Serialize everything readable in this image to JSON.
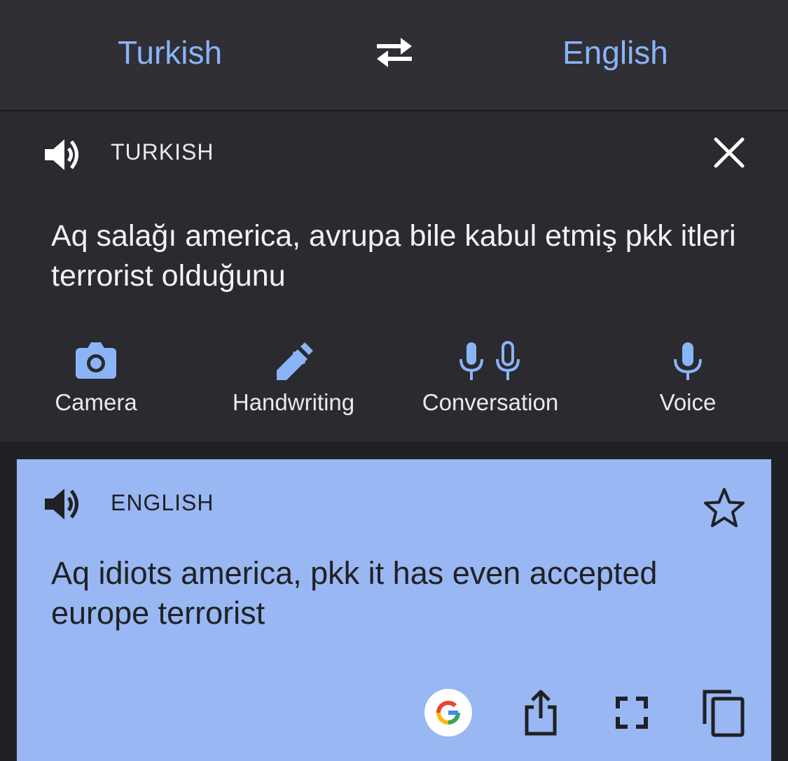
{
  "language_bar": {
    "source_language": "Turkish",
    "target_language": "English",
    "swap_icon": "swap-arrows-icon"
  },
  "input_panel": {
    "label": "TURKISH",
    "text": "Aq salağı america, avrupa bile kabul etmiş pkk itleri terrorist olduğunu",
    "tools": [
      {
        "label": "Camera",
        "icon": "camera-icon"
      },
      {
        "label": "Handwriting",
        "icon": "pen-icon"
      },
      {
        "label": "Conversation",
        "icon": "dual-microphone-icon"
      },
      {
        "label": "Voice",
        "icon": "microphone-icon"
      }
    ]
  },
  "output_panel": {
    "label": "ENGLISH",
    "text": "Aq idiots america, pkk it has even accepted europe terrorist",
    "actions": [
      "google-icon",
      "share-icon",
      "fullscreen-icon",
      "copy-icon"
    ]
  },
  "colors": {
    "accent": "#8ab4f8",
    "output_background": "#99b7f2",
    "dark_background": "#2a2a2f"
  }
}
